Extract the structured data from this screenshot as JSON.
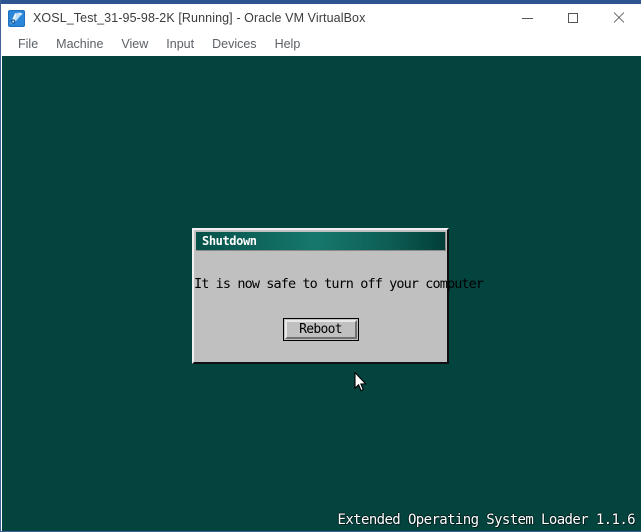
{
  "window": {
    "title": "XOSL_Test_31-95-98-2K [Running] - Oracle VM VirtualBox",
    "icon": "virtualbox-logo-icon",
    "accent_color": "#2b5490",
    "controls": {
      "minimize": "minimize-icon",
      "maximize": "maximize-icon",
      "close": "close-icon"
    }
  },
  "menubar": {
    "items": [
      {
        "label": "File"
      },
      {
        "label": "Machine"
      },
      {
        "label": "View"
      },
      {
        "label": "Input"
      },
      {
        "label": "Devices"
      },
      {
        "label": "Help"
      }
    ]
  },
  "guest": {
    "background_color": "#04443f",
    "branding": "Extended Operating System Loader 1.1.6",
    "cursor": "mouse-pointer-icon",
    "dialog": {
      "title": "Shutdown",
      "title_gradient_from": "#045048",
      "title_gradient_to": "#16786d",
      "message": "It is now safe to turn off your computer",
      "button_label": "Reboot",
      "face_color": "#c0c0c0"
    }
  }
}
